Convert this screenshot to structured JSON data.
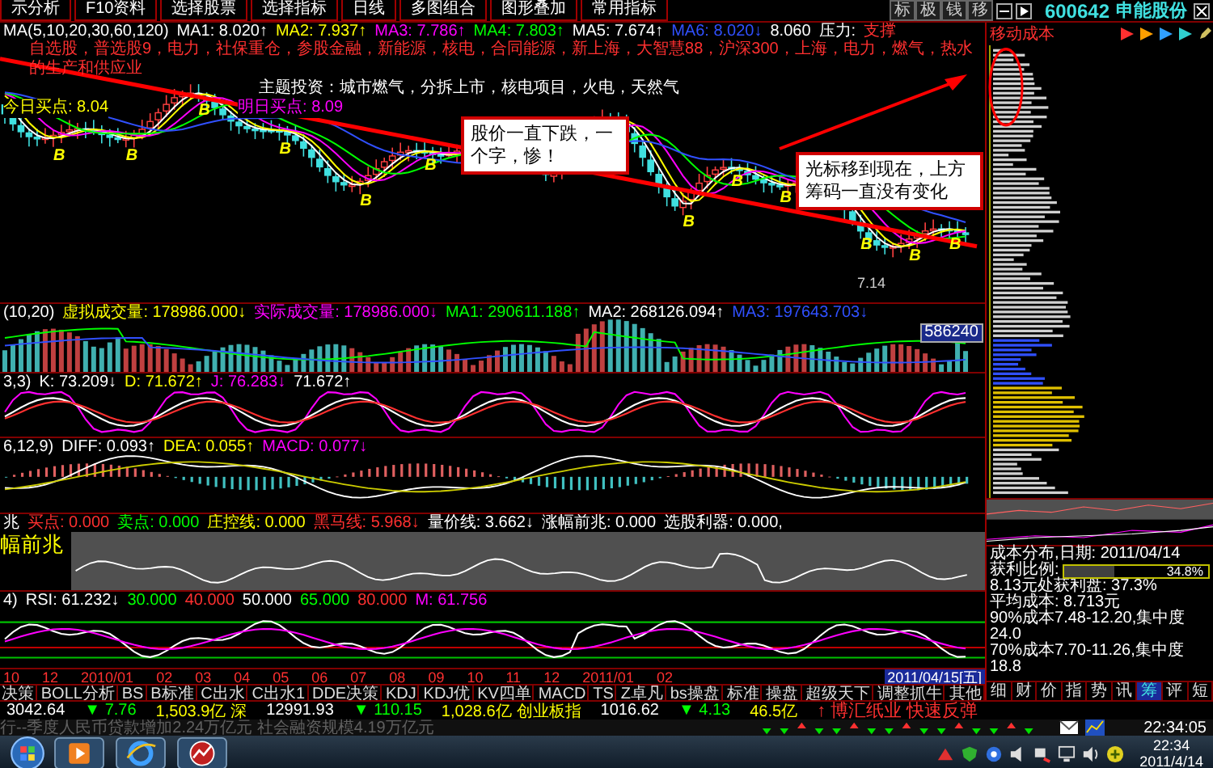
{
  "toolbar": {
    "tabs": [
      "示分析",
      "F10资料",
      "选择股票",
      "选择指标",
      "日线",
      "多图组合",
      "图形叠加",
      "常用指标"
    ],
    "tool_buttons": [
      "标",
      "极",
      "钱",
      "移"
    ],
    "stock_code": "600642",
    "stock_name": "申能股份"
  },
  "price_panel": {
    "ma_items": [
      {
        "text": "MA(5,10,20,30,60,120)",
        "color": "#ffffff"
      },
      {
        "text": "MA1: 8.020",
        "arrow": "↑",
        "color": "#ffffff"
      },
      {
        "text": "MA2: 7.937",
        "arrow": "↑",
        "color": "#ffff00"
      },
      {
        "text": "MA3: 7.786",
        "arrow": "↑",
        "color": "#ff00ff"
      },
      {
        "text": "MA4: 7.803",
        "arrow": "↑",
        "color": "#00ff00"
      },
      {
        "text": "MA5: 7.674",
        "arrow": "↑",
        "color": "#ffffff"
      },
      {
        "text": "MA6: 8.020",
        "arrow": "↓",
        "color": "#3050ff"
      },
      {
        "text": "8.060",
        "color": "#ffffff"
      }
    ],
    "pressure_label": "压力:",
    "support_label": "支撑",
    "concepts": "自选股，普选股9，电力，社保重仓，参股金融，新能源，核电，合同能源，新上海，大智慧88，沪深300，上海，电力，燃气，热水的生产和供应业",
    "themes": "主题投资：城市燃气，分拆上市，核电项目，火电，天然气",
    "today_buy": "今日买点: 8.04",
    "tomorrow_buy": "明日买点: 8.09",
    "low_label": "7.14",
    "buy_markers": [
      "B",
      "B",
      "B",
      "B",
      "B",
      "B",
      "B",
      "B",
      "B",
      "B",
      "B",
      "B"
    ],
    "callouts": [
      "股价一直下跌，一个字，惨！",
      "光标移到现在，上方筹码一直没有变化"
    ]
  },
  "volume_panel": {
    "params": "(10,20)",
    "items": [
      {
        "text": "虚拟成交量: 178986.000",
        "arrow": "↓",
        "kind": "main"
      },
      {
        "text": "实际成交量: 178986.000",
        "arrow": "↓",
        "kind": "aux"
      },
      {
        "text": "MA1: 290611.188",
        "arrow": "↑",
        "kind": "signal"
      },
      {
        "text": "MA2: 268126.094",
        "arrow": "↑",
        "kind": "plain"
      },
      {
        "text": "MA3: 197643.703",
        "arrow": "↓",
        "kind": "avg"
      }
    ],
    "badge": "586240"
  },
  "kdj_panel": {
    "params": "3,3)",
    "items": [
      {
        "text": "K: 73.209",
        "arrow": "↓",
        "kind": "plain"
      },
      {
        "text": "D: 71.672",
        "arrow": "↑",
        "kind": "main"
      },
      {
        "text": "J: 76.283",
        "arrow": "↓",
        "kind": "aux"
      },
      {
        "text": "71.672",
        "arrow": "↑",
        "kind": "plain"
      }
    ]
  },
  "macd_panel": {
    "params": "6,12,9)",
    "items": [
      {
        "text": "DIFF: 0.093",
        "arrow": "↑",
        "kind": "plain"
      },
      {
        "text": "DEA: 0.055",
        "arrow": "↑",
        "kind": "main"
      },
      {
        "text": "MACD: 0.077",
        "arrow": "↓",
        "kind": "aux"
      }
    ]
  },
  "signal_panel": {
    "params": "兆",
    "items": [
      {
        "text": "买点: 0.000",
        "kind": "alert"
      },
      {
        "text": "卖点: 0.000",
        "kind": "signal"
      },
      {
        "text": "庄控线: 0.000",
        "kind": "main"
      },
      {
        "text": "黑马线: 5.968",
        "arrow": "↓",
        "kind": "alert"
      },
      {
        "text": "量价线: 3.662",
        "arrow": "↓",
        "kind": "plain"
      },
      {
        "text": "涨幅前兆: 0.000",
        "kind": "plain"
      },
      {
        "text": "选股利器: 0.000,",
        "kind": "plain"
      }
    ],
    "title": "幅前兆"
  },
  "rsi_panel": {
    "params": "4)",
    "items": [
      {
        "text": "RSI: 61.232",
        "arrow": "↓",
        "kind": "plain"
      },
      {
        "text": "30.000",
        "kind": "signal"
      },
      {
        "text": "40.000",
        "kind": "alert"
      },
      {
        "text": "50.000",
        "kind": "plain"
      },
      {
        "text": "65.000",
        "kind": "signal"
      },
      {
        "text": "80.000",
        "kind": "alert"
      },
      {
        "text": "M: 61.756",
        "kind": "aux"
      }
    ]
  },
  "date_axis": {
    "labels": [
      "10",
      "12",
      "2010/01",
      "02",
      "03",
      "04",
      "05",
      "06",
      "07",
      "08",
      "09",
      "10",
      "11",
      "12",
      "2011/01",
      "02"
    ],
    "cursor_date": "2011/04/15[五]"
  },
  "indicator_tabs": [
    "决策",
    "BOLL分析",
    "BS",
    "B标准",
    "C出水",
    "C出水1",
    "DDE决策",
    "KDJ",
    "KDJ优",
    "KV四单",
    "MACD",
    "TS",
    "Z卓凡",
    "bs操盘",
    "标准",
    "操盘",
    "超级天下",
    "调整抓牛",
    "其他"
  ],
  "chip_panel": {
    "title": "移动成本",
    "info_title": "成本分布,日期: 2011/04/14",
    "profit_label": "获利比例:",
    "profit": {
      "level": 0.348,
      "reading": "34.8%"
    },
    "info_lines": [
      "8.13元处获利盘: 37.3%",
      "平均成本: 8.713元",
      "90%成本7.48-12.20,集中度24.0",
      "70%成本7.70-11.26,集中度18.8"
    ],
    "tabs": [
      {
        "label": "细",
        "selected": false
      },
      {
        "label": "财",
        "selected": false
      },
      {
        "label": "价",
        "selected": false
      },
      {
        "label": "指",
        "selected": false
      },
      {
        "label": "势",
        "selected": false
      },
      {
        "label": "讯",
        "selected": false
      },
      {
        "label": "筹",
        "selected": true
      },
      {
        "label": "评",
        "selected": false
      },
      {
        "label": "短",
        "selected": false
      }
    ]
  },
  "status_bar": [
    {
      "text": "3042.64",
      "kind": "index"
    },
    {
      "text": "▼ 7.76",
      "kind": "down"
    },
    {
      "text": "1,503.9亿",
      "kind": "amount"
    },
    {
      "text": "深",
      "kind": "name"
    },
    {
      "text": "12991.93",
      "kind": "index"
    },
    {
      "text": "▼ 110.15",
      "kind": "down"
    },
    {
      "text": "1,028.6亿",
      "kind": "amount"
    },
    {
      "text": "创业板指",
      "kind": "name"
    },
    {
      "text": "1016.62",
      "kind": "index"
    },
    {
      "text": "▼ 4.13",
      "kind": "down"
    },
    {
      "text": "46.5亿",
      "kind": "amount"
    },
    {
      "text": "↑ 博汇纸业 快速反弹",
      "kind": "alert"
    }
  ],
  "ticker": {
    "news": "行--季度人民币贷款增加2.24万亿元 社会融资规模4.19万亿元",
    "time": "22:34:05"
  },
  "taskbar": {
    "time": "22:34",
    "date": "2011/4/14"
  }
}
